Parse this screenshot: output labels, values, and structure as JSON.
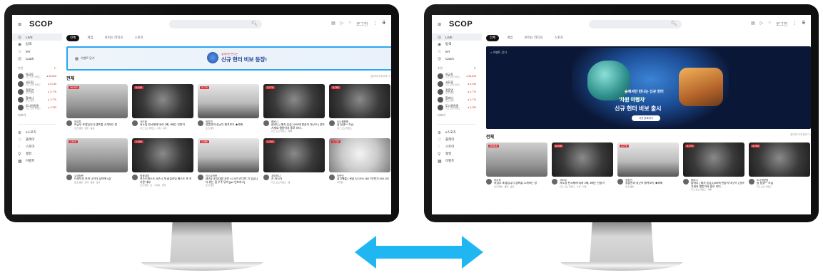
{
  "app": {
    "logo": "SCOP",
    "search_icon": "🔍︎",
    "grid_icon": "⠿"
  },
  "topbar_icons": [
    "▤",
    "▷",
    "○",
    "로그인",
    "⋮"
  ],
  "nav": [
    {
      "icon": "◎",
      "label": "LIVE"
    },
    {
      "icon": "◉",
      "label": "탐색"
    },
    {
      "icon": "☆",
      "label": "MY"
    },
    {
      "icon": "◎",
      "label": "Catch"
    }
  ],
  "sidebar_head": "추천",
  "streamers": [
    {
      "name": "하금투",
      "sub": "리그 오브 레전드",
      "viewers": "● 45,815"
    },
    {
      "name": "서도팀",
      "sub": "리그 오브 레전드",
      "viewers": "● 5,245"
    },
    {
      "name": "정훈연",
      "sub": "토크/캠방",
      "viewers": "● 3,776"
    },
    {
      "name": "합바니",
      "sub": "토크/캠방",
      "viewers": "● 3,776"
    },
    {
      "name": "도나원원원",
      "sub": "리그 오브 레전드",
      "viewers": "● 3,783"
    }
  ],
  "sidebar_more": "더보기",
  "sidebar_extra": [
    {
      "icon": "⊕",
      "label": "e스포츠"
    },
    {
      "icon": "♡",
      "label": "플레이"
    },
    {
      "icon": "◌",
      "label": "스토어"
    },
    {
      "icon": "⚲",
      "label": "랭킹"
    },
    {
      "icon": "▦",
      "label": "이벤트"
    }
  ],
  "tabs": [
    "전체",
    "게임",
    "보이는 라디오",
    "스포츠"
  ],
  "banner_small": {
    "close": "이벤트 닫기",
    "sub": "숲에서만 만나는",
    "main": "신규 헌터 비보 등장!"
  },
  "banner_big": {
    "close": "× 이벤트 닫기",
    "t1": "숲에서만 만나는 신규 헌터",
    "t2": "'차원 여행자'",
    "t3": "신규 헌터 비보 출시",
    "btn": "사전 등록하기"
  },
  "section": {
    "title": "전체",
    "more": "참여하기/추천하기 ›"
  },
  "row1": [
    {
      "style": "th-room",
      "badge": "45,815",
      "name": "하금투",
      "title": "하금투 초캠입니다 캠프를 소개하는 방",
      "tags": "토크/캠방 · 캠방 · 음료"
    },
    {
      "style": "th-game",
      "badge": "5,245",
      "name": "서도팀",
      "title": "서도팀 한국제에 내려 2배, 4배는 인방이",
      "tags": "리그 오브 레전드 · 시청 · 외계"
    },
    {
      "style": "th-desk",
      "badge": "3,776",
      "name": "정훈연",
      "title": "정훈연과 정군이 챙겨보기 ★봐봐",
      "tags": "토크/캠방"
    },
    {
      "style": "th-game",
      "badge": "3,776",
      "name": "합바니",
      "title": "합바니 | 매치 승점 1000에 한숨이 대구이 | 알아가세요 열받아서 중로 리더..",
      "tags": "리그 오브 레전드 · 배틀"
    },
    {
      "style": "th-game",
      "badge": "3,783",
      "name": "도나원원원",
      "title": "콤 됨겠^^ 즈끔",
      "tags": "리그 오브 레전드"
    }
  ],
  "row2": [
    {
      "style": "th-room",
      "badge": "2,515",
      "name": "누에정복",
      "title": "트레탁선 포커 나이더 참여에 4장",
      "tags": "토크/캠방 · 트레 · 몸짱 · 날씨"
    },
    {
      "style": "th-game",
      "badge": "2,396",
      "name": "휘청데마",
      "title": "포스트캐스트 시즌 4 개 중점선팀 베스트 포 속 가문 대부",
      "tags": "토크/캠방 · 포 · 사이버 · 앙바"
    },
    {
      "style": "th-desk",
      "badge": "1,986",
      "name": "이스트박현",
      "title": "[회자] 네 상대방 코인 시 시력 잔디만 가 있습니다 위는 짐 우주 뒤어 [jax 인프라스]",
      "tags": "토크/캠방"
    },
    {
      "style": "th-game",
      "badge": "1,753",
      "name": "꼬마하니",
      "title": "콘-하시다",
      "tags": "리그 오브 레전드 · 캠"
    },
    {
      "style": "th-anime",
      "badge": "1,726",
      "name": "마란닷",
      "title": "광고패를 ( 관합 사 10% 180 7년만기 000 100",
      "tags": "버추얼"
    }
  ],
  "colors": {
    "accent": "#2aa7f0",
    "arrow": "#1fb6f2"
  }
}
